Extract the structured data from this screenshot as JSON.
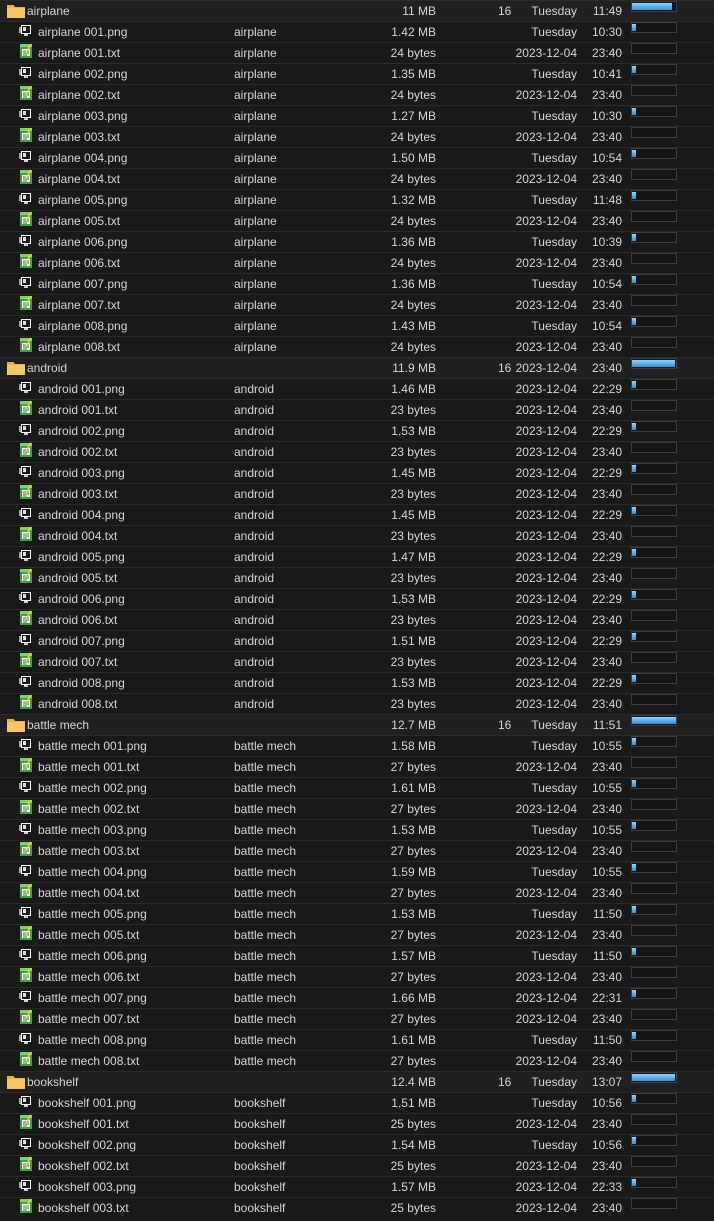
{
  "groups": [
    {
      "name": "airplane",
      "size": "11 MB",
      "count": "16",
      "day": "Tuesday",
      "time": "11:49",
      "usage_fraction": 0.9,
      "files": [
        {
          "name": "airplane 001.png",
          "parent": "airplane",
          "size": "1.42 MB",
          "day": "Tuesday",
          "time": "10:30",
          "type": "png",
          "usage_fraction": 0.08
        },
        {
          "name": "airplane 001.txt",
          "parent": "airplane",
          "size": "24 bytes",
          "day": "2023-12-04",
          "time": "23:40",
          "type": "txt",
          "usage_fraction": 0
        },
        {
          "name": "airplane 002.png",
          "parent": "airplane",
          "size": "1.35 MB",
          "day": "Tuesday",
          "time": "10:41",
          "type": "png",
          "usage_fraction": 0.08
        },
        {
          "name": "airplane 002.txt",
          "parent": "airplane",
          "size": "24 bytes",
          "day": "2023-12-04",
          "time": "23:40",
          "type": "txt",
          "usage_fraction": 0
        },
        {
          "name": "airplane 003.png",
          "parent": "airplane",
          "size": "1.27 MB",
          "day": "Tuesday",
          "time": "10:30",
          "type": "png",
          "usage_fraction": 0.08
        },
        {
          "name": "airplane 003.txt",
          "parent": "airplane",
          "size": "24 bytes",
          "day": "2023-12-04",
          "time": "23:40",
          "type": "txt",
          "usage_fraction": 0
        },
        {
          "name": "airplane 004.png",
          "parent": "airplane",
          "size": "1.50 MB",
          "day": "Tuesday",
          "time": "10:54",
          "type": "png",
          "usage_fraction": 0.08
        },
        {
          "name": "airplane 004.txt",
          "parent": "airplane",
          "size": "24 bytes",
          "day": "2023-12-04",
          "time": "23:40",
          "type": "txt",
          "usage_fraction": 0
        },
        {
          "name": "airplane 005.png",
          "parent": "airplane",
          "size": "1.32 MB",
          "day": "Tuesday",
          "time": "11:48",
          "type": "png",
          "usage_fraction": 0.08
        },
        {
          "name": "airplane 005.txt",
          "parent": "airplane",
          "size": "24 bytes",
          "day": "2023-12-04",
          "time": "23:40",
          "type": "txt",
          "usage_fraction": 0
        },
        {
          "name": "airplane 006.png",
          "parent": "airplane",
          "size": "1.36 MB",
          "day": "Tuesday",
          "time": "10:39",
          "type": "png",
          "usage_fraction": 0.08
        },
        {
          "name": "airplane 006.txt",
          "parent": "airplane",
          "size": "24 bytes",
          "day": "2023-12-04",
          "time": "23:40",
          "type": "txt",
          "usage_fraction": 0
        },
        {
          "name": "airplane 007.png",
          "parent": "airplane",
          "size": "1.36 MB",
          "day": "Tuesday",
          "time": "10:54",
          "type": "png",
          "usage_fraction": 0.08
        },
        {
          "name": "airplane 007.txt",
          "parent": "airplane",
          "size": "24 bytes",
          "day": "2023-12-04",
          "time": "23:40",
          "type": "txt",
          "usage_fraction": 0
        },
        {
          "name": "airplane 008.png",
          "parent": "airplane",
          "size": "1.43 MB",
          "day": "Tuesday",
          "time": "10:54",
          "type": "png",
          "usage_fraction": 0.08
        },
        {
          "name": "airplane 008.txt",
          "parent": "airplane",
          "size": "24 bytes",
          "day": "2023-12-04",
          "time": "23:40",
          "type": "txt",
          "usage_fraction": 0
        }
      ]
    },
    {
      "name": "android",
      "size": "11.9 MB",
      "count": "16",
      "day": "2023-12-04",
      "time": "23:40",
      "usage_fraction": 0.97,
      "files": [
        {
          "name": "android 001.png",
          "parent": "android",
          "size": "1.46 MB",
          "day": "2023-12-04",
          "time": "22:29",
          "type": "png",
          "usage_fraction": 0.08
        },
        {
          "name": "android 001.txt",
          "parent": "android",
          "size": "23 bytes",
          "day": "2023-12-04",
          "time": "23:40",
          "type": "txt",
          "usage_fraction": 0
        },
        {
          "name": "android 002.png",
          "parent": "android",
          "size": "1.53 MB",
          "day": "2023-12-04",
          "time": "22:29",
          "type": "png",
          "usage_fraction": 0.08
        },
        {
          "name": "android 002.txt",
          "parent": "android",
          "size": "23 bytes",
          "day": "2023-12-04",
          "time": "23:40",
          "type": "txt",
          "usage_fraction": 0
        },
        {
          "name": "android 003.png",
          "parent": "android",
          "size": "1.45 MB",
          "day": "2023-12-04",
          "time": "22:29",
          "type": "png",
          "usage_fraction": 0.08
        },
        {
          "name": "android 003.txt",
          "parent": "android",
          "size": "23 bytes",
          "day": "2023-12-04",
          "time": "23:40",
          "type": "txt",
          "usage_fraction": 0
        },
        {
          "name": "android 004.png",
          "parent": "android",
          "size": "1.45 MB",
          "day": "2023-12-04",
          "time": "22:29",
          "type": "png",
          "usage_fraction": 0.08
        },
        {
          "name": "android 004.txt",
          "parent": "android",
          "size": "23 bytes",
          "day": "2023-12-04",
          "time": "23:40",
          "type": "txt",
          "usage_fraction": 0
        },
        {
          "name": "android 005.png",
          "parent": "android",
          "size": "1.47 MB",
          "day": "2023-12-04",
          "time": "22:29",
          "type": "png",
          "usage_fraction": 0.08
        },
        {
          "name": "android 005.txt",
          "parent": "android",
          "size": "23 bytes",
          "day": "2023-12-04",
          "time": "23:40",
          "type": "txt",
          "usage_fraction": 0
        },
        {
          "name": "android 006.png",
          "parent": "android",
          "size": "1.53 MB",
          "day": "2023-12-04",
          "time": "22:29",
          "type": "png",
          "usage_fraction": 0.08
        },
        {
          "name": "android 006.txt",
          "parent": "android",
          "size": "23 bytes",
          "day": "2023-12-04",
          "time": "23:40",
          "type": "txt",
          "usage_fraction": 0
        },
        {
          "name": "android 007.png",
          "parent": "android",
          "size": "1.51 MB",
          "day": "2023-12-04",
          "time": "22:29",
          "type": "png",
          "usage_fraction": 0.08
        },
        {
          "name": "android 007.txt",
          "parent": "android",
          "size": "23 bytes",
          "day": "2023-12-04",
          "time": "23:40",
          "type": "txt",
          "usage_fraction": 0
        },
        {
          "name": "android 008.png",
          "parent": "android",
          "size": "1.53 MB",
          "day": "2023-12-04",
          "time": "22:29",
          "type": "png",
          "usage_fraction": 0.08
        },
        {
          "name": "android 008.txt",
          "parent": "android",
          "size": "23 bytes",
          "day": "2023-12-04",
          "time": "23:40",
          "type": "txt",
          "usage_fraction": 0
        }
      ]
    },
    {
      "name": "battle mech",
      "size": "12.7 MB",
      "count": "16",
      "day": "Tuesday",
      "time": "11:51",
      "usage_fraction": 1.0,
      "files": [
        {
          "name": "battle mech 001.png",
          "parent": "battle mech",
          "size": "1.58 MB",
          "day": "Tuesday",
          "time": "10:55",
          "type": "png",
          "usage_fraction": 0.08
        },
        {
          "name": "battle mech 001.txt",
          "parent": "battle mech",
          "size": "27 bytes",
          "day": "2023-12-04",
          "time": "23:40",
          "type": "txt",
          "usage_fraction": 0
        },
        {
          "name": "battle mech 002.png",
          "parent": "battle mech",
          "size": "1.61 MB",
          "day": "Tuesday",
          "time": "10:55",
          "type": "png",
          "usage_fraction": 0.08
        },
        {
          "name": "battle mech 002.txt",
          "parent": "battle mech",
          "size": "27 bytes",
          "day": "2023-12-04",
          "time": "23:40",
          "type": "txt",
          "usage_fraction": 0
        },
        {
          "name": "battle mech 003.png",
          "parent": "battle mech",
          "size": "1.53 MB",
          "day": "Tuesday",
          "time": "10:55",
          "type": "png",
          "usage_fraction": 0.08
        },
        {
          "name": "battle mech 003.txt",
          "parent": "battle mech",
          "size": "27 bytes",
          "day": "2023-12-04",
          "time": "23:40",
          "type": "txt",
          "usage_fraction": 0
        },
        {
          "name": "battle mech 004.png",
          "parent": "battle mech",
          "size": "1.59 MB",
          "day": "Tuesday",
          "time": "10:55",
          "type": "png",
          "usage_fraction": 0.08
        },
        {
          "name": "battle mech 004.txt",
          "parent": "battle mech",
          "size": "27 bytes",
          "day": "2023-12-04",
          "time": "23:40",
          "type": "txt",
          "usage_fraction": 0
        },
        {
          "name": "battle mech 005.png",
          "parent": "battle mech",
          "size": "1.53 MB",
          "day": "Tuesday",
          "time": "11:50",
          "type": "png",
          "usage_fraction": 0.08
        },
        {
          "name": "battle mech 005.txt",
          "parent": "battle mech",
          "size": "27 bytes",
          "day": "2023-12-04",
          "time": "23:40",
          "type": "txt",
          "usage_fraction": 0
        },
        {
          "name": "battle mech 006.png",
          "parent": "battle mech",
          "size": "1.57 MB",
          "day": "Tuesday",
          "time": "11:50",
          "type": "png",
          "usage_fraction": 0.08
        },
        {
          "name": "battle mech 006.txt",
          "parent": "battle mech",
          "size": "27 bytes",
          "day": "2023-12-04",
          "time": "23:40",
          "type": "txt",
          "usage_fraction": 0
        },
        {
          "name": "battle mech 007.png",
          "parent": "battle mech",
          "size": "1.66 MB",
          "day": "2023-12-04",
          "time": "22:31",
          "type": "png",
          "usage_fraction": 0.08
        },
        {
          "name": "battle mech 007.txt",
          "parent": "battle mech",
          "size": "27 bytes",
          "day": "2023-12-04",
          "time": "23:40",
          "type": "txt",
          "usage_fraction": 0
        },
        {
          "name": "battle mech 008.png",
          "parent": "battle mech",
          "size": "1.61 MB",
          "day": "Tuesday",
          "time": "11:50",
          "type": "png",
          "usage_fraction": 0.08
        },
        {
          "name": "battle mech 008.txt",
          "parent": "battle mech",
          "size": "27 bytes",
          "day": "2023-12-04",
          "time": "23:40",
          "type": "txt",
          "usage_fraction": 0
        }
      ]
    },
    {
      "name": "bookshelf",
      "size": "12.4 MB",
      "count": "16",
      "day": "Tuesday",
      "time": "13:07",
      "usage_fraction": 0.98,
      "files": [
        {
          "name": "bookshelf 001.png",
          "parent": "bookshelf",
          "size": "1.51 MB",
          "day": "Tuesday",
          "time": "10:56",
          "type": "png",
          "usage_fraction": 0.08
        },
        {
          "name": "bookshelf 001.txt",
          "parent": "bookshelf",
          "size": "25 bytes",
          "day": "2023-12-04",
          "time": "23:40",
          "type": "txt",
          "usage_fraction": 0
        },
        {
          "name": "bookshelf 002.png",
          "parent": "bookshelf",
          "size": "1.54 MB",
          "day": "Tuesday",
          "time": "10:56",
          "type": "png",
          "usage_fraction": 0.08
        },
        {
          "name": "bookshelf 002.txt",
          "parent": "bookshelf",
          "size": "25 bytes",
          "day": "2023-12-04",
          "time": "23:40",
          "type": "txt",
          "usage_fraction": 0
        },
        {
          "name": "bookshelf 003.png",
          "parent": "bookshelf",
          "size": "1.57 MB",
          "day": "2023-12-04",
          "time": "22:33",
          "type": "png",
          "usage_fraction": 0.08
        },
        {
          "name": "bookshelf 003.txt",
          "parent": "bookshelf",
          "size": "25 bytes",
          "day": "2023-12-04",
          "time": "23:40",
          "type": "txt",
          "usage_fraction": 0
        }
      ]
    }
  ]
}
